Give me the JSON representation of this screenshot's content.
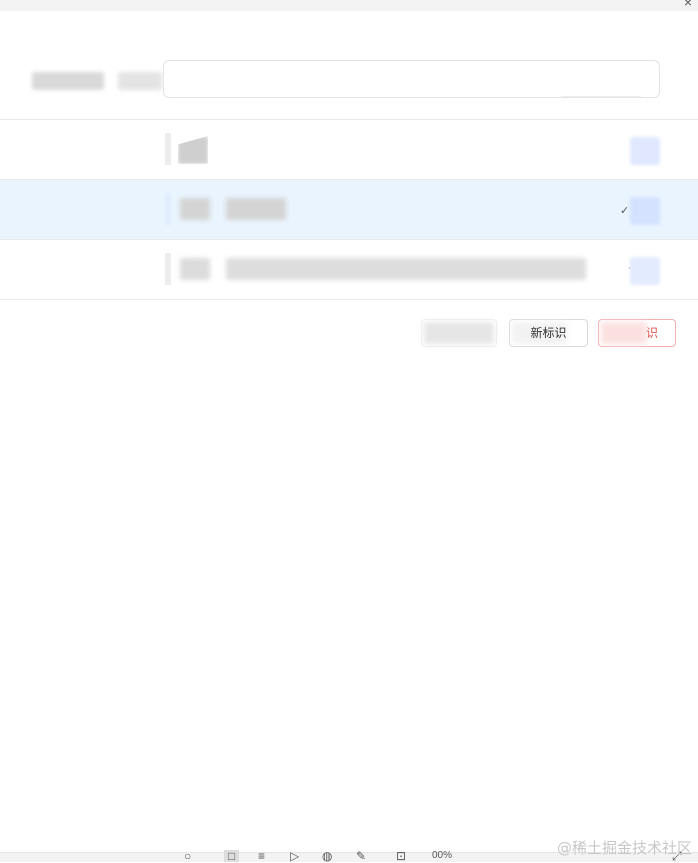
{
  "window": {
    "close_glyph": "×"
  },
  "search": {
    "placeholder": ""
  },
  "rows": [
    {
      "selected": false,
      "tick": ""
    },
    {
      "selected": true,
      "tick": "✓"
    },
    {
      "selected": false,
      "tick": "·"
    }
  ],
  "buttons": {
    "first_label": "",
    "second_label": "新标识",
    "third_label": "识"
  },
  "statusbar": {
    "zoom": "00%"
  },
  "watermark": "@稀土掘金技术社区",
  "colors": {
    "selected_row": "#eaf4fe",
    "danger": "#e05555",
    "accent_chip": "#dfe8ff"
  }
}
